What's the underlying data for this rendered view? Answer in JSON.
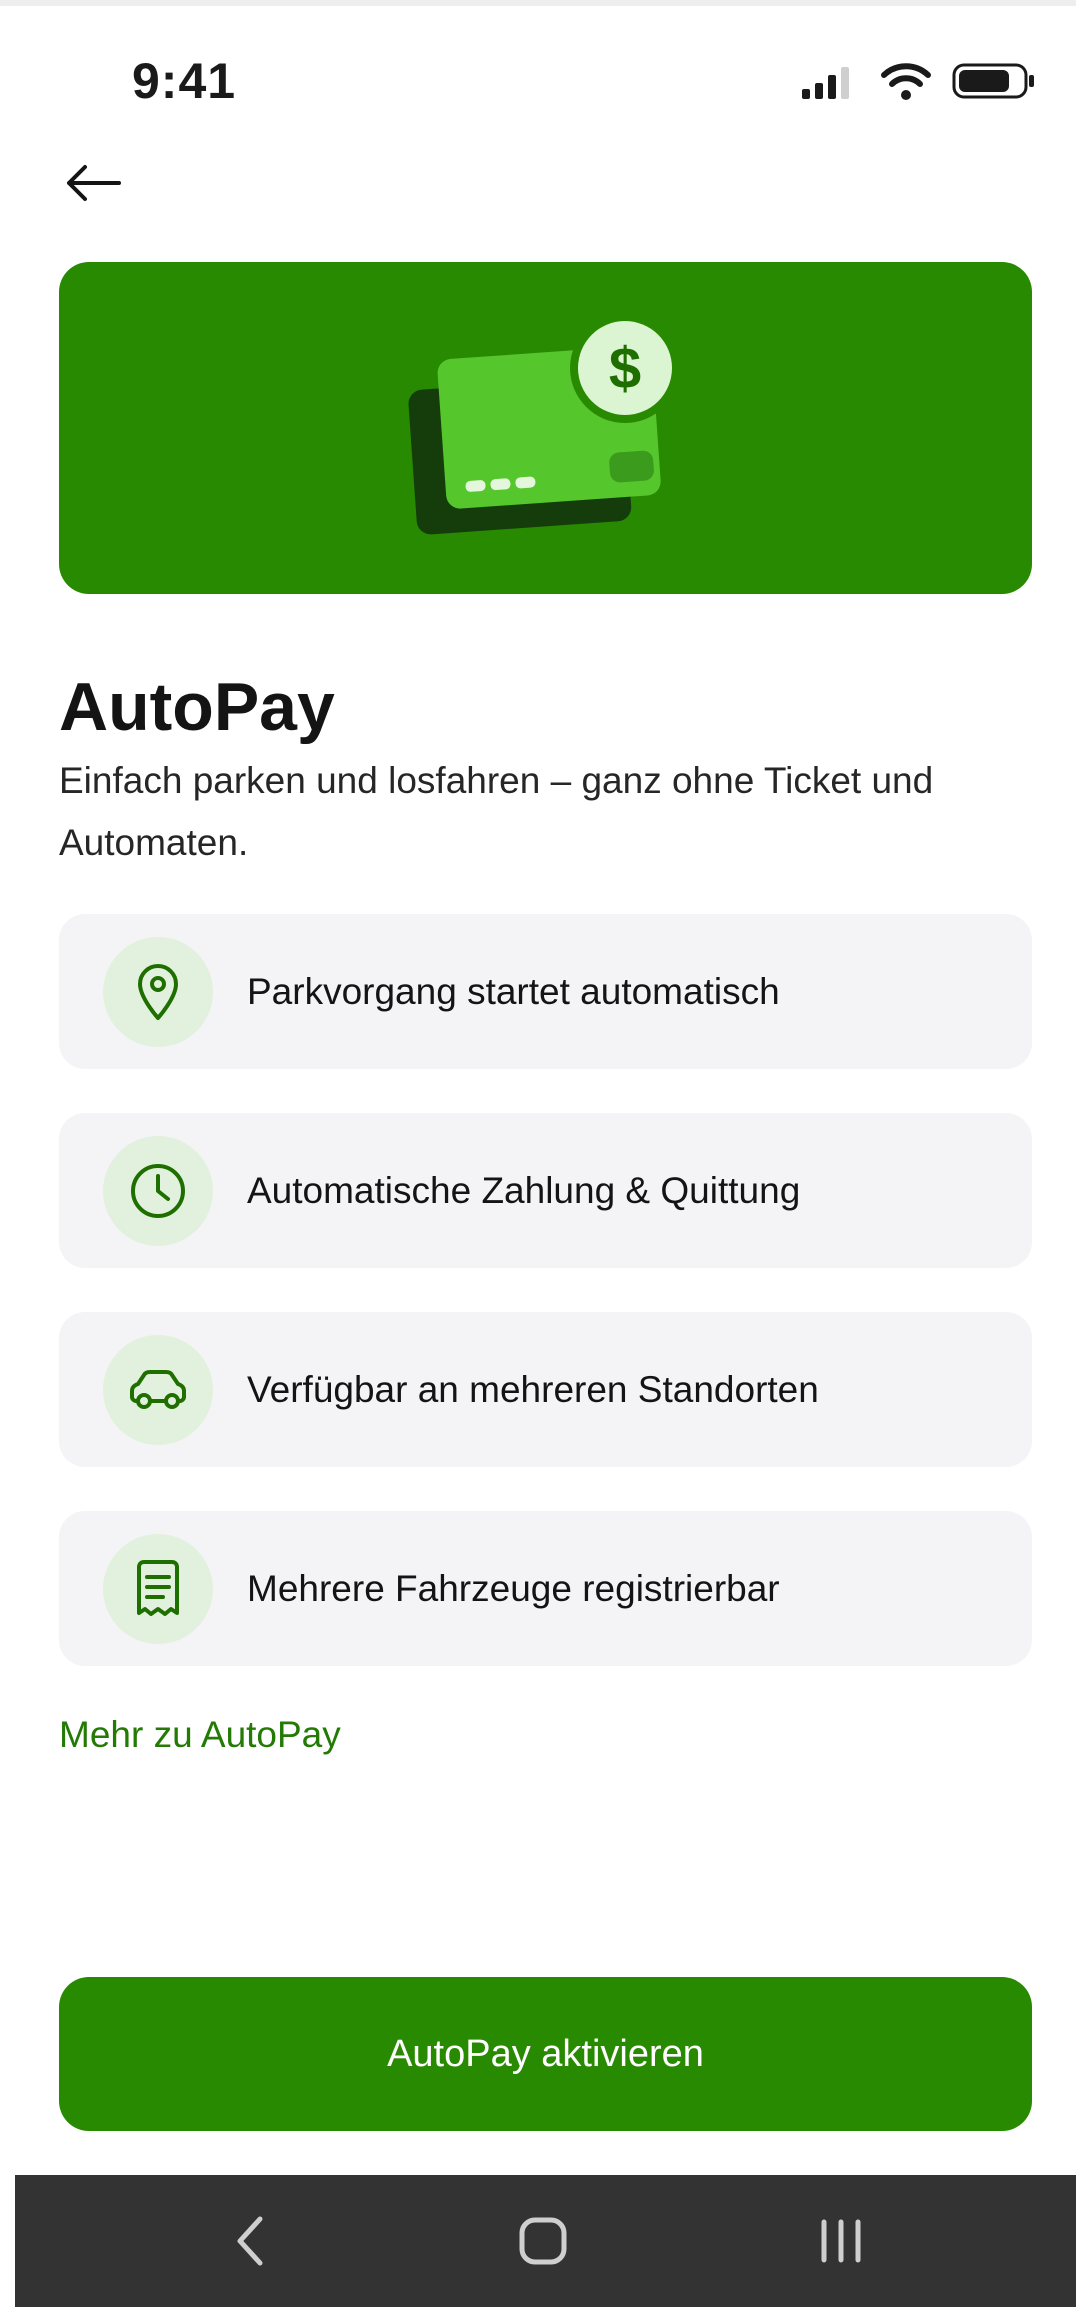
{
  "status_bar": {
    "time": "9:41",
    "icons": [
      "cellular-signal-icon",
      "wifi-icon",
      "battery-icon"
    ]
  },
  "header": {
    "back_icon": "arrow-left-icon"
  },
  "hero": {
    "illustration": "credit-card-dollar-coin-illustration",
    "background_color": "#288a00"
  },
  "content": {
    "title": "AutoPay",
    "subtitle_line1": "Einfach parken und losfahren – ganz ohne Ticket und",
    "subtitle_line2": "Automaten."
  },
  "features": [
    {
      "icon": "location-pin-icon",
      "label": "Parkvorgang startet automatisch"
    },
    {
      "icon": "clock-icon",
      "label": "Automatische Zahlung & Quittung"
    },
    {
      "icon": "car-icon",
      "label": "Verfügbar an mehreren Standorten"
    },
    {
      "icon": "receipt-icon",
      "label": "Mehrere Fahrzeuge registrierbar"
    }
  ],
  "links": {
    "more": "Mehr zu AutoPay"
  },
  "actions": {
    "primary": "AutoPay aktivieren"
  },
  "system_nav": {
    "buttons": [
      "back-nav-icon",
      "home-nav-icon",
      "recent-apps-icon"
    ]
  },
  "colors": {
    "brand_green": "#288a00",
    "link_green": "#237a05",
    "card_background": "#f4f4f6",
    "icon_circle": "#e2f1de",
    "nav_bar": "#333333"
  }
}
